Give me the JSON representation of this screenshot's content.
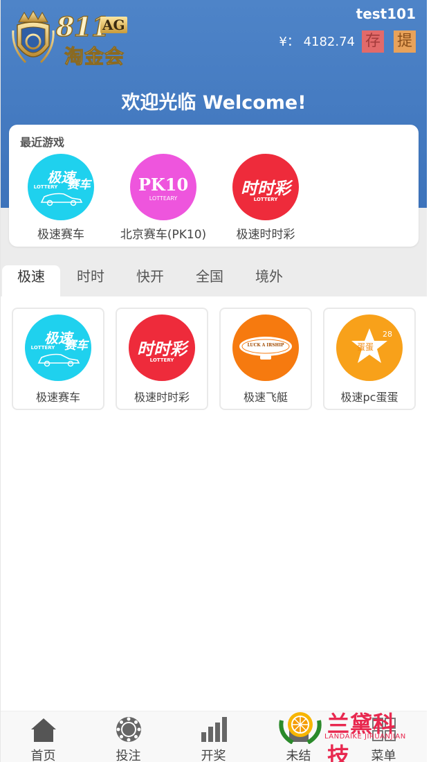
{
  "header": {
    "logo": {
      "number": "811",
      "suffix": "AG",
      "brand_cn": "淘金会"
    },
    "username": "test101",
    "balance_label": "¥：",
    "balance_value": "4182.74",
    "deposit_label": "存",
    "withdraw_label": "提",
    "welcome": "欢迎光临 Welcome!"
  },
  "recent": {
    "title": "最近游戏",
    "items": [
      {
        "name": "极速赛车",
        "icon": "speed-racing-icon",
        "color": "#1fd1ee"
      },
      {
        "name": "北京赛车(PK10)",
        "icon": "pk10-icon",
        "color": "#ee55dd"
      },
      {
        "name": "极速时时彩",
        "icon": "shishicai-icon",
        "color": "#ee2b3b"
      }
    ]
  },
  "tabs": [
    {
      "label": "极速",
      "active": true
    },
    {
      "label": "时时"
    },
    {
      "label": "快开"
    },
    {
      "label": "全国"
    },
    {
      "label": "境外"
    }
  ],
  "games": [
    {
      "name": "极速赛车",
      "icon": "speed-racing-icon",
      "color": "#1fd1ee"
    },
    {
      "name": "极速时时彩",
      "icon": "shishicai-icon",
      "color": "#ee2b3b"
    },
    {
      "name": "极速飞艇",
      "icon": "airship-icon",
      "color": "#f67a0f"
    },
    {
      "name": "极速pc蛋蛋",
      "icon": "pc-egg-icon",
      "color": "#f8a11a"
    }
  ],
  "icon_text": {
    "racing_line1": "极速",
    "racing_line2": "赛车",
    "racing_sub": "LOTTERY",
    "pk10": "PK10",
    "pk10_sub": "LOTTEARY",
    "ssc": "时时彩",
    "ssc_sub": "LOTTERY",
    "airship": "LUCK A IRSHIP",
    "egg_num": "28",
    "egg_cn": "蛋蛋"
  },
  "bottom_nav": [
    {
      "label": "首页",
      "icon": "home-icon"
    },
    {
      "label": "投注",
      "icon": "chip-icon"
    },
    {
      "label": "开奖",
      "icon": "bar-chart-icon"
    },
    {
      "label": "未结",
      "icon": "unsettled-icon"
    },
    {
      "label": "菜单",
      "icon": "menu-grid-icon"
    }
  ],
  "watermark": {
    "cn": "兰黛科技",
    "en": "LANDAIKE JIRUANJIAN"
  },
  "colors": {
    "header_blue": "#4479c0",
    "deposit": "#e26a6a",
    "withdraw": "#e8a25a",
    "watermark": "#e8284f"
  }
}
